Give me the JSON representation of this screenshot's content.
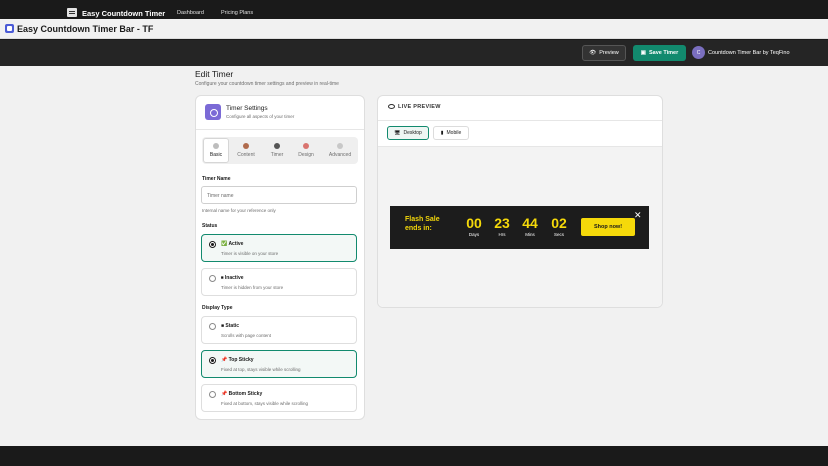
{
  "window": {
    "title": "Easy Countdown Timer Bar - TF"
  },
  "nav": {
    "brand": "Easy Countdown Timer",
    "links": [
      "Dashboard",
      "Pricing Plans"
    ],
    "preview_label": "Preview",
    "save_label": "Save Timer",
    "avatar_initial": "C",
    "store_name": "Countdown Timer Bar by TeqFino"
  },
  "page": {
    "title": "Edit Timer",
    "subtitle": "Configure your countdown timer settings and preview in real-time"
  },
  "settings": {
    "title": "Timer Settings",
    "subtitle": "Configure all aspects of your timer",
    "tabs": [
      {
        "label": "Basic",
        "active": true
      },
      {
        "label": "Content",
        "active": false
      },
      {
        "label": "Timer",
        "active": false
      },
      {
        "label": "Design",
        "active": false
      },
      {
        "label": "Advanced",
        "active": false
      }
    ],
    "timer_name": {
      "label": "Timer Name",
      "placeholder": "Timer name",
      "help": "Internal name for your reference only"
    },
    "status": {
      "label": "Status",
      "options": [
        {
          "label": "Active",
          "desc": "Timer is visible on your store",
          "selected": true
        },
        {
          "label": "Inactive",
          "desc": "Timer is hidden from your store",
          "selected": false
        }
      ]
    },
    "display_type": {
      "label": "Display Type",
      "options": [
        {
          "label": "Static",
          "desc": "Scrolls with page content",
          "selected": false
        },
        {
          "label": "Top Sticky",
          "desc": "Fixed at top, stays visible while scrolling",
          "selected": true
        },
        {
          "label": "Bottom Sticky",
          "desc": "Fixed at bottom, stays visible while scrolling",
          "selected": false
        }
      ]
    }
  },
  "preview": {
    "title": "LIVE PREVIEW",
    "device_tabs": [
      "Desktop",
      "Mobile"
    ],
    "selected_device": "Desktop",
    "bar": {
      "message_line1": "Flash Sale",
      "message_line2": "ends in:",
      "units": [
        {
          "value": "00",
          "label": "Days"
        },
        {
          "value": "23",
          "label": "Hrs"
        },
        {
          "value": "44",
          "label": "Mins"
        },
        {
          "value": "02",
          "label": "Secs"
        }
      ],
      "button_label": "Shop now!",
      "colors": {
        "background": "#1c1c1c",
        "accent": "#f5d90a"
      }
    }
  },
  "colors": {
    "primary": "#128a6e",
    "nav_bg": "#252525",
    "page_bg": "#f1f1f1"
  }
}
